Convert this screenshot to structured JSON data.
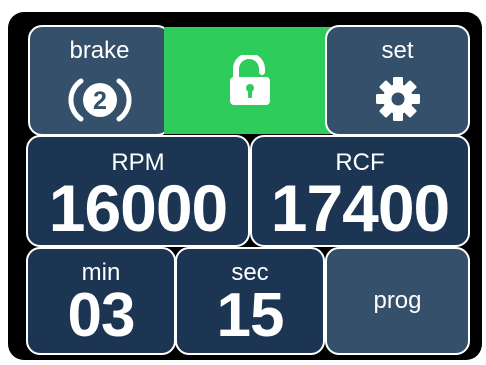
{
  "brake": {
    "label": "brake",
    "level": "2",
    "icon": "brake-level-icon"
  },
  "lock": {
    "icon": "unlock-icon",
    "state": "unlocked",
    "color": "#2ecc5a"
  },
  "set": {
    "label": "set",
    "icon": "gear-icon"
  },
  "rpm": {
    "label": "RPM",
    "value": "16000"
  },
  "rcf": {
    "label": "RCF",
    "value": "17400"
  },
  "time": {
    "min_label": "min",
    "min_value": "03",
    "sec_label": "sec",
    "sec_value": "15"
  },
  "prog": {
    "label": "prog"
  },
  "colors": {
    "tile_slate": "#34506b",
    "tile_navy": "#1c3553",
    "accent_green": "#2ecc5a",
    "background": "#000000"
  }
}
